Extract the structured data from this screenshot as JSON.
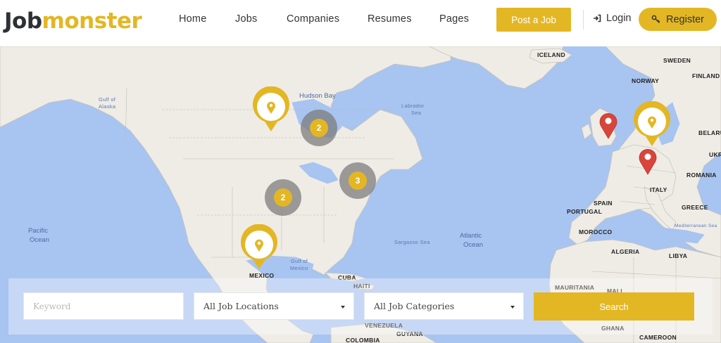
{
  "header": {
    "logo_part1": "Job",
    "logo_part2": "monster",
    "nav": [
      "Home",
      "Jobs",
      "Companies",
      "Resumes",
      "Pages"
    ],
    "post_job_label": "Post a Job",
    "login_label": "Login",
    "register_label": "Register",
    "accent_color": "#e3b724"
  },
  "map": {
    "labels": {
      "iceland": "ICELAND",
      "sweden": "SWEDEN",
      "finland": "FINLAND",
      "norway": "NORWAY",
      "belarus": "BELARU",
      "ukraine": "UKR",
      "romania": "ROMANIA",
      "italy": "ITALY",
      "greece": "GREECE",
      "spain": "SPAIN",
      "portugal": "PORTUGAL",
      "morocco": "MOROCCO",
      "algeria": "ALGERIA",
      "libya": "LIBYA",
      "mauritania": "MAURITANIA",
      "mali": "MALI",
      "ghana": "GHANA",
      "cameroon": "CAMEROON",
      "mexico": "MEXICO",
      "cuba": "CUBA",
      "haiti": "HAITI",
      "venezuela": "VENEZUELA",
      "guyana": "GUYANA",
      "colombia": "COLOMBIA",
      "hudson_bay": "Hudson Bay",
      "gulf_alaska_1": "Gulf of",
      "gulf_alaska_2": "Alaska",
      "labrador_1": "Labrador",
      "labrador_2": "Sea",
      "pacific_1": "Pacific",
      "pacific_2": "Ocean",
      "atlantic_1": "Atlantic",
      "atlantic_2": "Ocean",
      "sargasso": "Sargasso Sea",
      "gulf_mexico_1": "Gulf of",
      "gulf_mexico_2": "Mexico",
      "mediterranean": "Mediterranean Sea"
    },
    "clusters": [
      "2",
      "3",
      "2"
    ],
    "pin_colors": {
      "job": "#e3b724",
      "company": "#d9453b"
    }
  },
  "search": {
    "keyword_placeholder": "Keyword",
    "location_value": "All Job Locations",
    "category_value": "All Job Categories",
    "search_label": "Search"
  }
}
